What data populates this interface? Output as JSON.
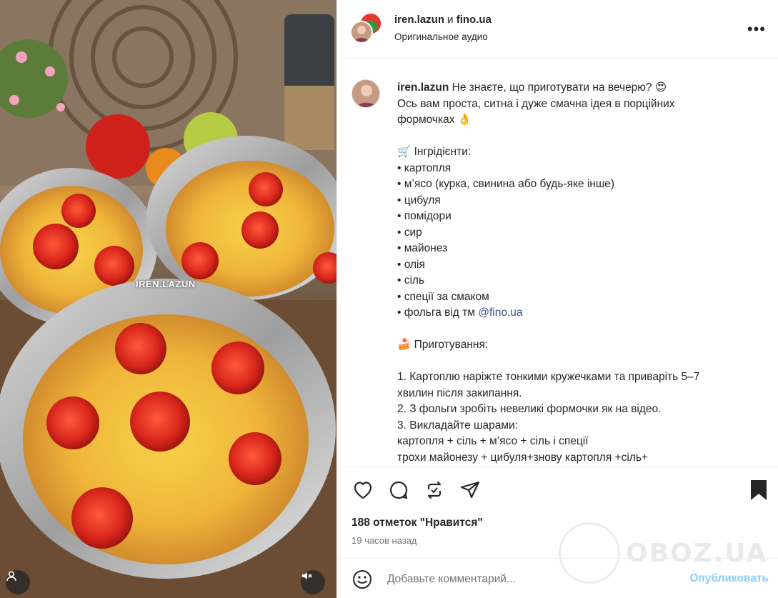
{
  "media": {
    "watermark": "IREN.LAZUN",
    "user_icon": "user-profile-icon",
    "mute_icon": "speaker-muted-icon"
  },
  "header": {
    "user1": "iren.lazun",
    "conjunction": " и ",
    "user2": "fino.ua",
    "audio": "Оригинальное аудио",
    "more_icon": "more-horizontal-icon"
  },
  "caption": {
    "username": "iren.lazun",
    "intro": " Не знаєте, що приготувати на вечерю? 😍",
    "line2": "Ось вам проста, ситна і дуже смачна ідея в порційних",
    "line3": "формочках 👌",
    "ingredients_title": "🛒 Інгрідієнти:",
    "ingredients": [
      "• картопля",
      "• м’ясо (курка, свинина або будь-яке інше)",
      "• цибуля",
      "• помідори",
      "• сир",
      "• майонез",
      "• олія",
      "• сіль",
      "• спеції за смаком"
    ],
    "foil_prefix": "• фольга від тм ",
    "foil_mention": "@fino.ua",
    "prep_title": "🍰 Приготування:",
    "steps": [
      "1. Картоплю наріжте тонкими кружечками та приваріть 5–7",
      "хвилин після закипання.",
      "2. З фольги зробіть невеликі формочки як на відео.",
      "3. Викладайте шарами:",
      "картопля + сіль + м’ясо + сіль і спеції",
      "трохи майонезу + цибуля+знову картопля +сіль+"
    ]
  },
  "actions": {
    "like_icon": "heart-icon",
    "comment_icon": "comment-icon",
    "repost_icon": "repost-icon",
    "share_icon": "share-icon",
    "save_icon": "bookmark-icon",
    "likes": "188 отметок \"Нравится\"",
    "time": "19 часов назад"
  },
  "watermark_site": "OBOZ.UA",
  "comment": {
    "emoji_icon": "emoji-icon",
    "placeholder": "Добавьте комментарий...",
    "publish": "Опубликовать"
  },
  "colors": {
    "accent": "#0095f6",
    "mention": "#385185",
    "text": "#262626",
    "muted": "#737373"
  }
}
